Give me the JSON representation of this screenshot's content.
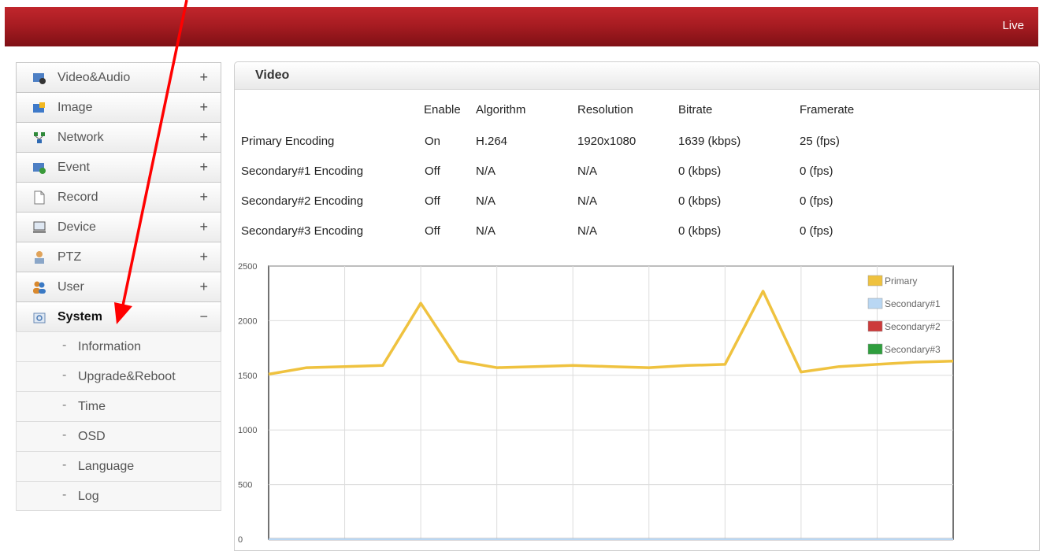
{
  "header": {
    "live_label": "Live"
  },
  "sidebar": {
    "items": [
      {
        "label": "Video&Audio",
        "toggle": "+",
        "icon": "video-audio-icon"
      },
      {
        "label": "Image",
        "toggle": "+",
        "icon": "image-icon"
      },
      {
        "label": "Network",
        "toggle": "+",
        "icon": "network-icon"
      },
      {
        "label": "Event",
        "toggle": "+",
        "icon": "event-icon"
      },
      {
        "label": "Record",
        "toggle": "+",
        "icon": "record-icon"
      },
      {
        "label": "Device",
        "toggle": "+",
        "icon": "device-icon"
      },
      {
        "label": "PTZ",
        "toggle": "+",
        "icon": "ptz-icon"
      },
      {
        "label": "User",
        "toggle": "+",
        "icon": "user-icon"
      },
      {
        "label": "System",
        "toggle": "−",
        "icon": "system-icon",
        "active": true
      }
    ],
    "sub_items": [
      {
        "bullet": "-",
        "label": "Information"
      },
      {
        "bullet": "-",
        "label": "Upgrade&Reboot"
      },
      {
        "bullet": "-",
        "label": "Time"
      },
      {
        "bullet": "-",
        "label": "OSD"
      },
      {
        "bullet": "-",
        "label": "Language"
      },
      {
        "bullet": "-",
        "label": "Log"
      }
    ]
  },
  "panel": {
    "title": "Video",
    "columns": [
      "Enable",
      "Algorithm",
      "Resolution",
      "Bitrate",
      "Framerate"
    ],
    "rows": [
      {
        "name": "Primary Encoding",
        "enable": "On",
        "algorithm": "H.264",
        "resolution": "1920x1080",
        "bitrate": "1639 (kbps)",
        "framerate": "25 (fps)"
      },
      {
        "name": "Secondary#1 Encoding",
        "enable": "Off",
        "algorithm": "N/A",
        "resolution": "N/A",
        "bitrate": "0 (kbps)",
        "framerate": "0 (fps)"
      },
      {
        "name": "Secondary#2 Encoding",
        "enable": "Off",
        "algorithm": "N/A",
        "resolution": "N/A",
        "bitrate": "0 (kbps)",
        "framerate": "0 (fps)"
      },
      {
        "name": "Secondary#3 Encoding",
        "enable": "Off",
        "algorithm": "N/A",
        "resolution": "N/A",
        "bitrate": "0 (kbps)",
        "framerate": "0 (fps)"
      }
    ]
  },
  "colors": {
    "header_red": "#a81c22",
    "annotation_arrow": "#ff0000"
  },
  "chart_data": {
    "type": "line",
    "title": "",
    "xlabel": "",
    "ylabel": "",
    "ylim": [
      0,
      2500
    ],
    "yticks": [
      0,
      500,
      1000,
      1500,
      2000,
      2500
    ],
    "grid": true,
    "legend_position": "top-right",
    "x": [
      0,
      1,
      2,
      3,
      4,
      5,
      6,
      7,
      8,
      9,
      10,
      11,
      12,
      13,
      14,
      15,
      16,
      17,
      18
    ],
    "series": [
      {
        "name": "Primary",
        "color": "#efc23f",
        "values": [
          1510,
          1570,
          1580,
          1590,
          2160,
          1630,
          1570,
          1580,
          1590,
          1580,
          1570,
          1590,
          1600,
          2270,
          1530,
          1580,
          1600,
          1620,
          1630
        ]
      },
      {
        "name": "Secondary#1",
        "color": "#b9d7f3",
        "values": [
          0,
          0,
          0,
          0,
          0,
          0,
          0,
          0,
          0,
          0,
          0,
          0,
          0,
          0,
          0,
          0,
          0,
          0,
          0
        ]
      },
      {
        "name": "Secondary#2",
        "color": "#cc3b3b",
        "values": [
          0,
          0,
          0,
          0,
          0,
          0,
          0,
          0,
          0,
          0,
          0,
          0,
          0,
          0,
          0,
          0,
          0,
          0,
          0
        ]
      },
      {
        "name": "Secondary#3",
        "color": "#2f9e3e",
        "values": [
          0,
          0,
          0,
          0,
          0,
          0,
          0,
          0,
          0,
          0,
          0,
          0,
          0,
          0,
          0,
          0,
          0,
          0,
          0
        ]
      }
    ]
  }
}
